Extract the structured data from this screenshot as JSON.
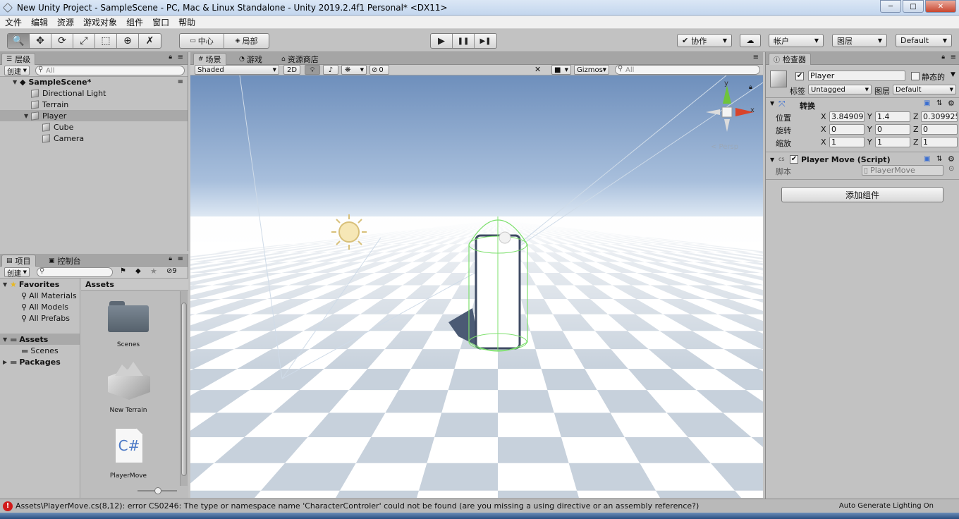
{
  "window": {
    "title": "New Unity Project - SampleScene - PC, Mac & Linux Standalone - Unity 2019.2.4f1 Personal* <DX11>",
    "minimize": "─",
    "maximize": "□",
    "close": "✕"
  },
  "menu": [
    "文件",
    "编辑",
    "资源",
    "游戏对象",
    "组件",
    "窗口",
    "帮助"
  ],
  "toolbar": {
    "tools": [
      {
        "name": "hand-tool",
        "glyph": "🔍",
        "active": true
      },
      {
        "name": "move-tool",
        "glyph": "✥",
        "active": false
      },
      {
        "name": "rotate-tool",
        "glyph": "⟳",
        "active": false
      },
      {
        "name": "scale-tool",
        "glyph": "⤢",
        "active": false
      },
      {
        "name": "rect-tool",
        "glyph": "⬚",
        "active": false
      },
      {
        "name": "transform-tool",
        "glyph": "⊕",
        "active": false
      },
      {
        "name": "custom-tool",
        "glyph": "✗",
        "active": false
      }
    ],
    "pivot_label": "中心",
    "space_label": "局部",
    "play": "▶",
    "pause": "❚❚",
    "step": "▶❚",
    "collab_label": "协作",
    "account_label": "帐户",
    "layers_label": "图层",
    "layout_label": "Default"
  },
  "hierarchy": {
    "tab_label": "层级",
    "create_label": "创建",
    "search_placeholder": "All",
    "scene_name": "SampleScene*",
    "items": [
      {
        "label": "Directional Light",
        "indent": 1,
        "expanded": null,
        "selected": false
      },
      {
        "label": "Terrain",
        "indent": 1,
        "expanded": null,
        "selected": false
      },
      {
        "label": "Player",
        "indent": 1,
        "expanded": true,
        "selected": true
      },
      {
        "label": "Cube",
        "indent": 2,
        "expanded": null,
        "selected": false
      },
      {
        "label": "Camera",
        "indent": 2,
        "expanded": null,
        "selected": false
      }
    ]
  },
  "scene_view": {
    "tabs": [
      "场景",
      "游戏",
      "资源商店"
    ],
    "shading_mode": "Shaded",
    "mode_2d": "2D",
    "effects_count": "0",
    "gizmos_label": "Gizmos",
    "search_placeholder": "All",
    "persp_label": "< Persp",
    "axis_y": "y",
    "axis_x": "x"
  },
  "project": {
    "tabs": [
      "项目",
      "控制台"
    ],
    "create_label": "创建",
    "hidden_count": "9",
    "favorites_label": "Favorites",
    "favorites": [
      "All Materials",
      "All Models",
      "All Prefabs"
    ],
    "assets_label": "Assets",
    "assets_children": [
      "Scenes"
    ],
    "packages_label": "Packages",
    "breadcrumb": "Assets",
    "files": [
      {
        "label": "Scenes",
        "kind": "folder"
      },
      {
        "label": "New Terrain",
        "kind": "terrain"
      },
      {
        "label": "PlayerMove",
        "kind": "script",
        "glyph": "C#"
      }
    ]
  },
  "inspector": {
    "tab_label": "检查器",
    "object_name": "Player",
    "static_label": "静态的",
    "tag_label": "标签",
    "tag_value": "Untagged",
    "layer_label": "图层",
    "layer_value": "Default",
    "transform": {
      "title": "转换",
      "position_label": "位置",
      "rotation_label": "旋转",
      "scale_label": "缩放",
      "axis_x": "X",
      "axis_y": "Y",
      "axis_z": "Z",
      "position": {
        "x": "3.84909",
        "y": "1.4",
        "z": "0.309925"
      },
      "rotation": {
        "x": "0",
        "y": "0",
        "z": "0"
      },
      "scale": {
        "x": "1",
        "y": "1",
        "z": "1"
      }
    },
    "script_component": {
      "title": "Player Move (Script)",
      "script_label": "脚本",
      "script_value": "PlayerMove"
    },
    "add_component_label": "添加组件"
  },
  "status": {
    "error_message": "Assets\\PlayerMove.cs(8,12): error CS0246: The type or namespace name 'CharacterControler' could not be found (are you missing a using directive or an assembly reference?)",
    "auto_lighting": "Auto Generate Lighting On"
  },
  "colors": {
    "error_icon": "#d11a1a",
    "selection_outline": "#7ee06e",
    "gizmo_y": "#6fc43c",
    "gizmo_x": "#d8442b"
  }
}
